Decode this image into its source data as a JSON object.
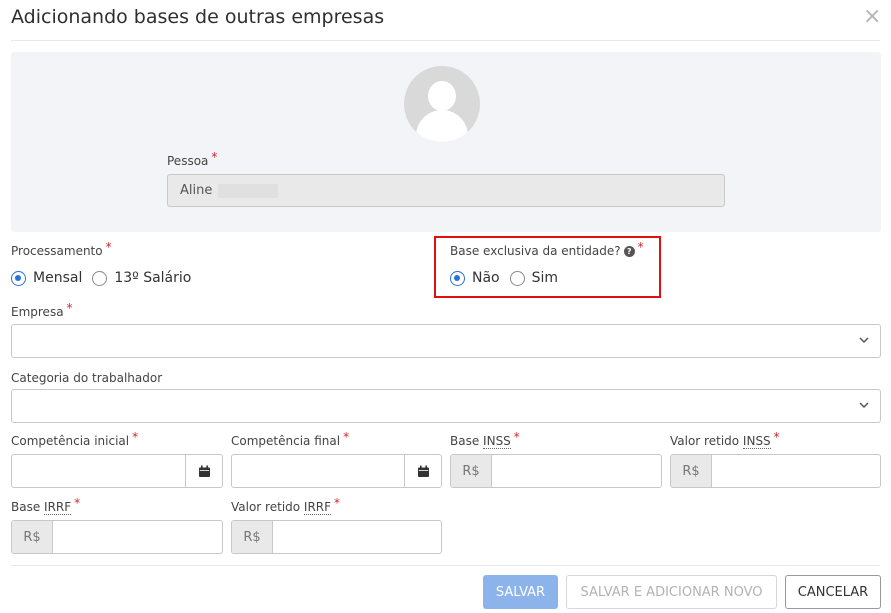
{
  "modal": {
    "title": "Adicionando bases de outras empresas",
    "close_symbol": "×"
  },
  "person": {
    "label": "Pessoa",
    "required": "*",
    "value": "Aline"
  },
  "processamento": {
    "label": "Processamento",
    "required": "*",
    "options": [
      {
        "label": "Mensal",
        "checked": true
      },
      {
        "label": "13º Salário",
        "checked": false
      }
    ]
  },
  "base_exclusiva": {
    "label": "Base exclusiva da entidade?",
    "help_symbol": "?",
    "required": "*",
    "options": [
      {
        "label": "Não",
        "checked": true
      },
      {
        "label": "Sim",
        "checked": false
      }
    ]
  },
  "empresa": {
    "label": "Empresa",
    "required": "*",
    "value": ""
  },
  "categoria": {
    "label": "Categoria do trabalhador",
    "value": ""
  },
  "competencia_inicial": {
    "label": "Competência inicial",
    "required": "*",
    "value": ""
  },
  "competencia_final": {
    "label": "Competência final",
    "required": "*",
    "value": ""
  },
  "base_inss": {
    "label_prefix": "Base ",
    "label_abbr": "INSS",
    "required": "*",
    "currency": "R$",
    "value": ""
  },
  "valor_retido_inss": {
    "label_prefix": "Valor retido ",
    "label_abbr": "INSS",
    "required": "*",
    "currency": "R$",
    "value": ""
  },
  "base_irrf": {
    "label_prefix": "Base ",
    "label_abbr": "IRRF",
    "required": "*",
    "currency": "R$",
    "value": ""
  },
  "valor_retido_irrf": {
    "label_prefix": "Valor retido ",
    "label_abbr": "IRRF",
    "required": "*",
    "currency": "R$",
    "value": ""
  },
  "buttons": {
    "save": "SALVAR",
    "save_new": "SALVAR E ADICIONAR NOVO",
    "cancel": "CANCELAR"
  },
  "colors": {
    "primary": "#2b72d6",
    "required": "#d9232d",
    "highlight": "#e01010",
    "save_disabled": "#8db4ea"
  },
  "icons": {
    "close": "close-icon",
    "avatar": "user-avatar-icon",
    "help": "help-icon",
    "calendar": "calendar-icon",
    "dropdown": "chevron-down-icon"
  }
}
